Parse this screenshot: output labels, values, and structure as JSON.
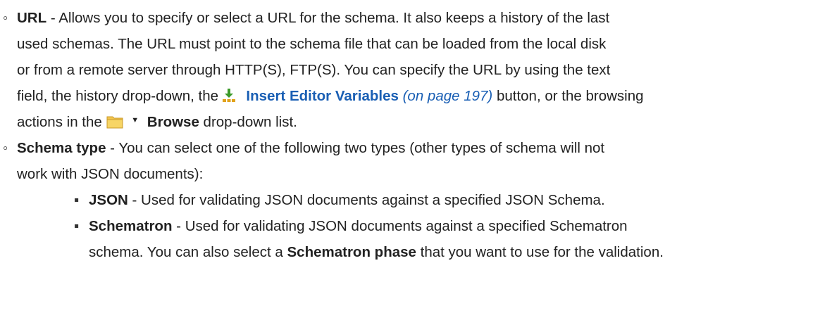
{
  "colors": {
    "link": "#1a5fb4",
    "text": "#222222",
    "icon_green": "#3c9a2a",
    "icon_gold": "#e1a21b",
    "folder": "#f3c64e"
  },
  "items": [
    {
      "bullet": "◦",
      "term": "URL",
      "lines": [
        " - Allows you to specify or select a URL for the schema. It also keeps a history of the last",
        "used schemas. The URL must point to the schema file that can be loaded from the local disk",
        "or from a remote server through HTTP(S), FTP(S). You can specify the URL by using the text"
      ],
      "line4_pre": "field, the history drop-down, the ",
      "line4_link": "Insert Editor Variables",
      "line4_ref": "(on page 197)",
      "line4_post": " button, or the browsing",
      "line5_pre": "actions in the ",
      "line5_bold": "Browse",
      "line5_post": " drop-down list.",
      "icons": [
        "insert-editor-variables-icon",
        "folder-icon",
        "dropdown-arrow-icon"
      ]
    },
    {
      "bullet": "◦",
      "term": "Schema type",
      "line1_post": " - You can select one of the following two types (other types of schema will not",
      "line2": "work with JSON documents):"
    }
  ],
  "subitems": [
    {
      "bullet": "▪",
      "term": "JSON",
      "text": " - Used for validating JSON documents against a specified JSON Schema."
    },
    {
      "bullet": "▪",
      "term": "Schematron",
      "text": " - Used for validating JSON documents against a specified Schematron",
      "line2_pre": "schema. You can also select a ",
      "line2_bold": "Schematron phase",
      "line2_post": " that you want to use for the validation."
    }
  ]
}
